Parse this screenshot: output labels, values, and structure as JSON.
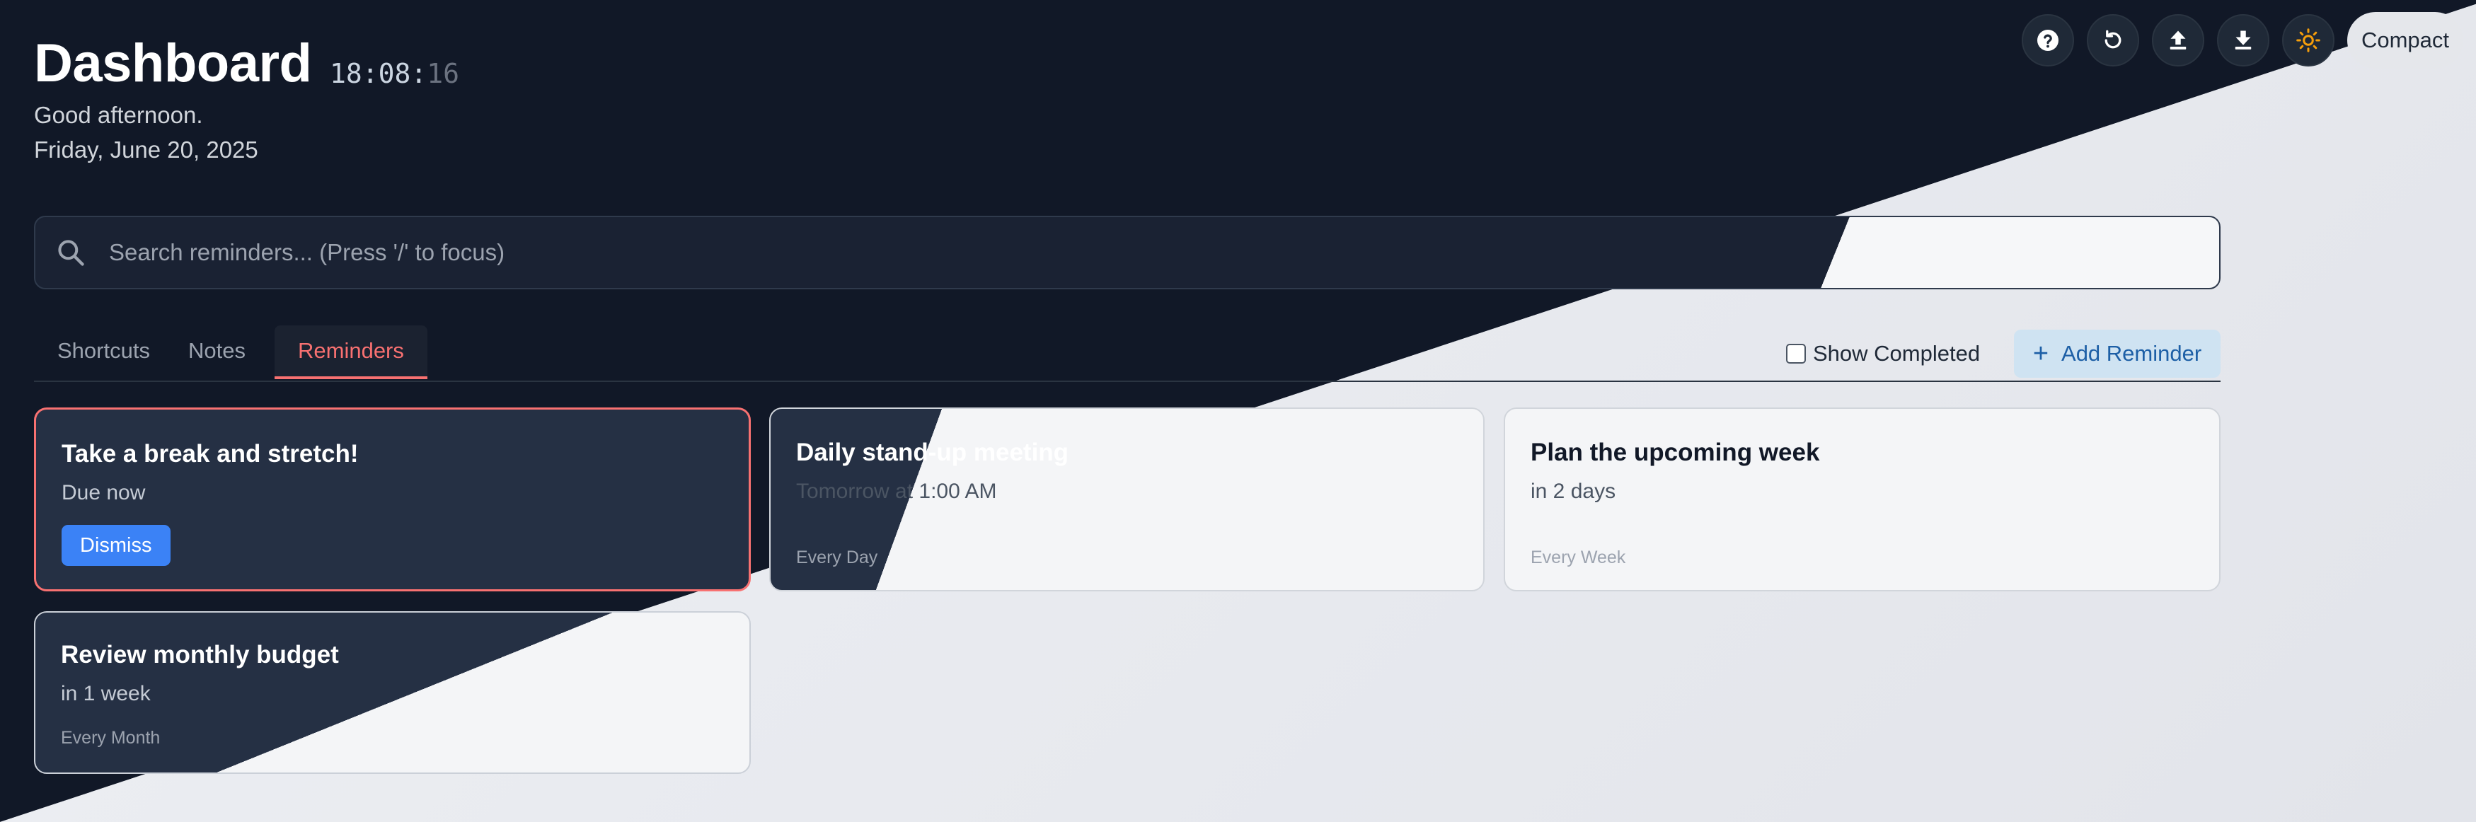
{
  "header": {
    "title": "Dashboard",
    "clock_hm": "18:08:",
    "clock_sec": "16",
    "greeting": "Good afternoon.",
    "date": "Friday, June 20, 2025"
  },
  "toolbar": {
    "icons": [
      "help-icon",
      "reset-icon",
      "upload-icon",
      "download-icon",
      "sun-icon"
    ],
    "compact_label": "Compact"
  },
  "search": {
    "placeholder": "Search reminders... (Press '/' to focus)",
    "value": ""
  },
  "tabs": [
    {
      "label": "Shortcuts",
      "active": false
    },
    {
      "label": "Notes",
      "active": false
    },
    {
      "label": "Reminders",
      "active": true
    }
  ],
  "controls": {
    "show_completed_label": "Show Completed",
    "show_completed_checked": false,
    "add_reminder_label": "Add Reminder"
  },
  "reminders": [
    {
      "title": "Take a break and stretch!",
      "due": "Due now",
      "action": "Dismiss",
      "recurrence": ""
    },
    {
      "title": "Daily stand-up meeting",
      "due": "Tomorrow at 1:00 AM",
      "recurrence": "Every Day"
    },
    {
      "title": "Plan the upcoming week",
      "due": "in 2 days",
      "recurrence": "Every Week"
    },
    {
      "title": "Review monthly budget",
      "due": "in 1 week",
      "recurrence": "Every Month"
    }
  ],
  "colors": {
    "dark_bg": "#111827",
    "light_bg": "#e8eaef",
    "accent_red": "#f87171",
    "accent_blue": "#3b82f6",
    "sun_icon": "#f59e0b"
  }
}
